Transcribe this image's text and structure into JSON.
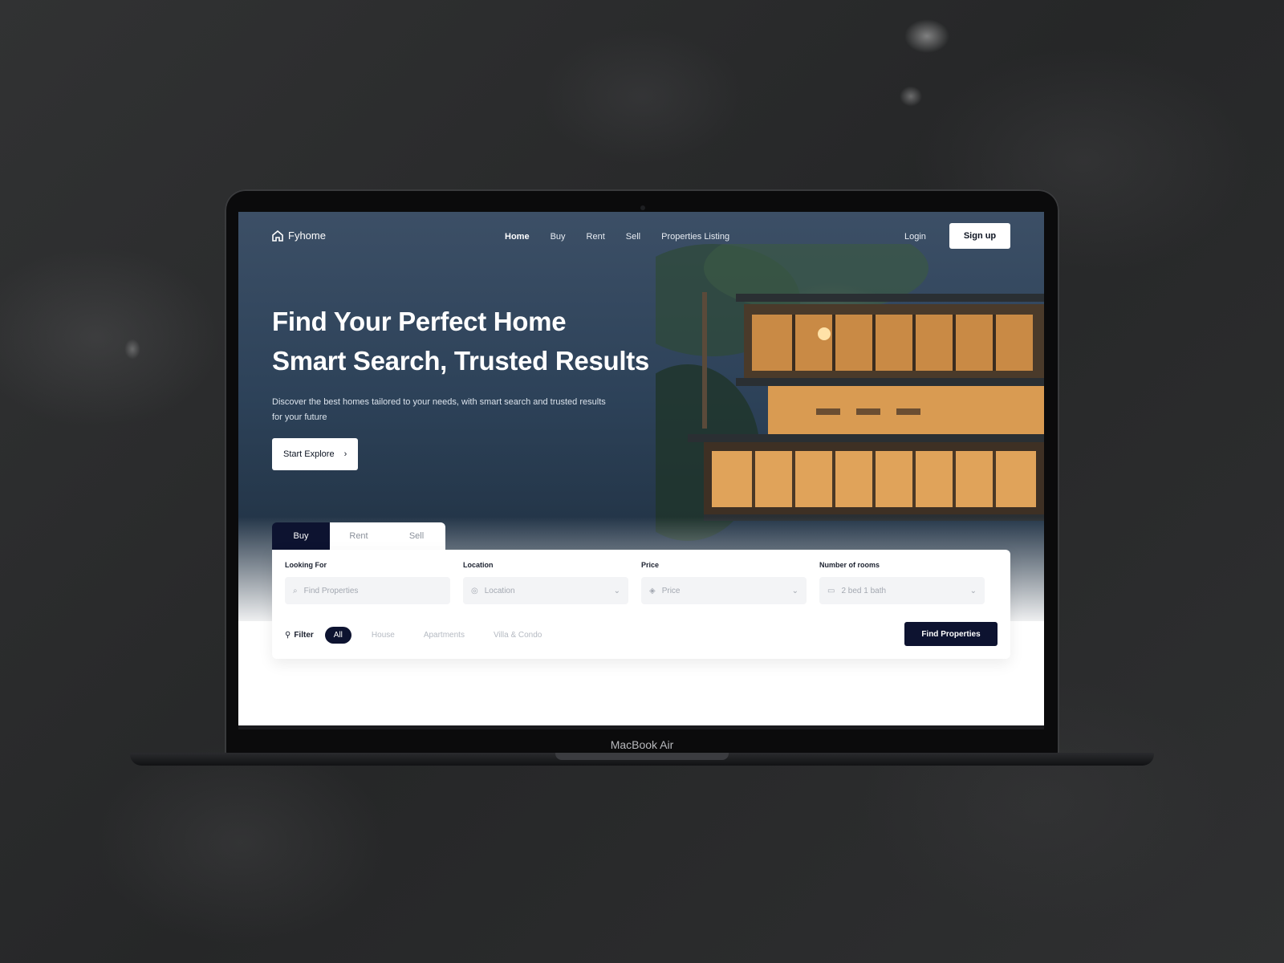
{
  "device": {
    "brand_label": "MacBook Air"
  },
  "header": {
    "logo_text": "Fyhome",
    "nav": [
      "Home",
      "Buy",
      "Rent",
      "Sell",
      "Properties Listing"
    ],
    "active_nav_index": 0,
    "login_label": "Login",
    "signup_label": "Sign up"
  },
  "hero": {
    "title_line1": "Find Your Perfect Home",
    "title_line2": "Smart Search, Trusted Results",
    "subtitle": "Discover the best homes tailored to your needs, with smart search and trusted results for your future",
    "cta_label": "Start Explore",
    "cta_icon": "arrow-right-icon"
  },
  "search": {
    "tabs": [
      "Buy",
      "Rent",
      "Sell"
    ],
    "active_tab_index": 0,
    "fields": [
      {
        "label": "Looking For",
        "placeholder": "Find Properties",
        "icon": "search-icon",
        "trailing_icon": ""
      },
      {
        "label": "Location",
        "placeholder": "Location",
        "icon": "pin-icon",
        "trailing_icon": "chevron-down-icon"
      },
      {
        "label": "Price",
        "placeholder": "Price",
        "icon": "tag-icon",
        "trailing_icon": "chevron-down-icon"
      },
      {
        "label": "Number of rooms",
        "placeholder": "2 bed 1 bath",
        "icon": "bed-icon",
        "trailing_icon": "chevron-down-icon"
      }
    ],
    "filter_label": "Filter",
    "filters": [
      "All",
      "House",
      "Apartments",
      "Villa & Condo"
    ],
    "active_filter_index": 0,
    "submit_label": "Find Properties"
  },
  "colors": {
    "accent": "#0d1330",
    "hero_sky": "#2d4259",
    "window_glow": "#e8a24a"
  }
}
